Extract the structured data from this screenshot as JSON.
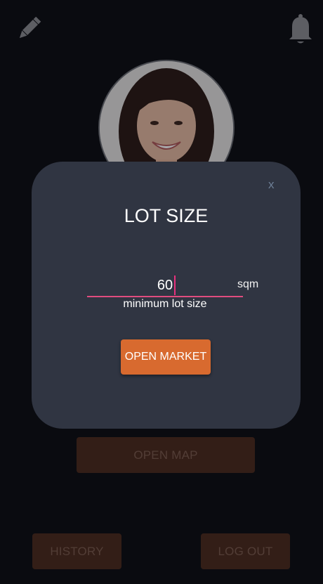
{
  "topbar": {
    "edit_icon": "pencil-icon",
    "notification_icon": "bell-icon"
  },
  "profile": {
    "avatar": "profile-photo"
  },
  "dialog": {
    "title": "LOT SIZE",
    "close_label": "x",
    "lot_size_value": "60",
    "unit_label": "sqm",
    "hint_label": "minimum lot size",
    "open_market_label": "OPEN MARKET"
  },
  "background_buttons": {
    "open_map_label": "OPEN MAP",
    "history_label": "HISTORY",
    "logout_label": "LOG OUT"
  },
  "colors": {
    "accent_orange": "#d86a2f",
    "muted_orange": "#4b2a1c",
    "dialog_bg": "#303542",
    "input_underline": "#e04d7f",
    "page_bg": "#0b0d12"
  }
}
